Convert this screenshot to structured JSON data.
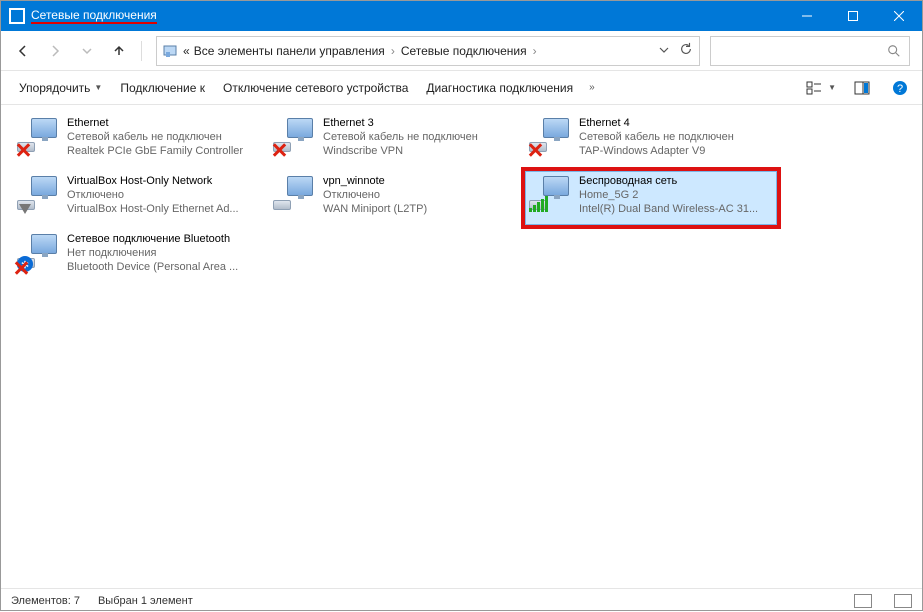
{
  "window": {
    "title": "Сетевые подключения"
  },
  "breadcrumbs": {
    "prefix": "«",
    "item1": "Все элементы панели управления",
    "item2": "Сетевые подключения"
  },
  "toolbar": {
    "organize": "Упорядочить",
    "connect_to": "Подключение к",
    "disable_device": "Отключение сетевого устройства",
    "diagnose": "Диагностика подключения"
  },
  "connections": [
    {
      "name": "Ethernet",
      "status": "Сетевой кабель не подключен",
      "device": "Realtek PCIe GbE Family Controller",
      "overlay": "cross",
      "selected": false,
      "highlighted": false
    },
    {
      "name": "Ethernet 3",
      "status": "Сетевой кабель не подключен",
      "device": "Windscribe VPN",
      "overlay": "cross",
      "selected": false,
      "highlighted": false
    },
    {
      "name": "Ethernet 4",
      "status": "Сетевой кабель не подключен",
      "device": "TAP-Windows Adapter V9",
      "overlay": "cross",
      "selected": false,
      "highlighted": false
    },
    {
      "name": "VirtualBox Host-Only Network",
      "status": "Отключено",
      "device": "VirtualBox Host-Only Ethernet Ad...",
      "overlay": "down",
      "selected": false,
      "highlighted": false
    },
    {
      "name": "vpn_winnote",
      "status": "Отключено",
      "device": "WAN Miniport (L2TP)",
      "overlay": "none",
      "selected": false,
      "highlighted": false
    },
    {
      "name": "Беспроводная сеть",
      "status": "Home_5G 2",
      "device": "Intel(R) Dual Band Wireless-AC 31...",
      "overlay": "wifi",
      "selected": true,
      "highlighted": true
    },
    {
      "name": "Сетевое подключение Bluetooth",
      "status": "Нет подключения",
      "device": "Bluetooth Device (Personal Area ...",
      "overlay": "bt-cross",
      "selected": false,
      "highlighted": false
    }
  ],
  "statusbar": {
    "count_label": "Элементов: 7",
    "selection_label": "Выбран 1 элемент"
  }
}
